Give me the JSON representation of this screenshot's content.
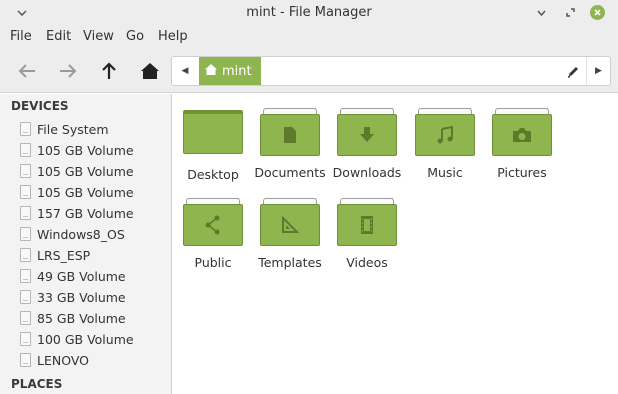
{
  "window": {
    "title": "mint - File Manager",
    "menu_icon": "chevron-down-icon",
    "minimize_icon": "minimize-icon",
    "maximize_icon": "maximize-icon",
    "close_icon": "close-icon",
    "accent": "#8fb54e"
  },
  "menubar": {
    "items": [
      "File",
      "Edit",
      "View",
      "Go",
      "Help"
    ]
  },
  "toolbar": {
    "back_icon": "arrow-left-icon",
    "forward_icon": "arrow-right-icon",
    "up_icon": "arrow-up-icon",
    "home_icon": "home-icon",
    "path": {
      "crumb_label": "mint",
      "crumb_icon": "home-icon",
      "edit_icon": "pencil-icon"
    }
  },
  "sidebar": {
    "devices_header": "DEVICES",
    "devices": [
      "File System",
      "105 GB Volume",
      "105 GB Volume",
      "105 GB Volume",
      "157 GB Volume",
      "Windows8_OS",
      "LRS_ESP",
      "49 GB Volume",
      "33 GB Volume",
      "85 GB Volume",
      "100 GB Volume",
      "LENOVO"
    ],
    "places_header": "PLACES"
  },
  "main": {
    "items": [
      {
        "label": "Desktop",
        "icon": "desktop-folder-icon"
      },
      {
        "label": "Documents",
        "icon": "documents-folder-icon"
      },
      {
        "label": "Downloads",
        "icon": "downloads-folder-icon"
      },
      {
        "label": "Music",
        "icon": "music-folder-icon"
      },
      {
        "label": "Pictures",
        "icon": "pictures-folder-icon"
      },
      {
        "label": "Public",
        "icon": "public-folder-icon"
      },
      {
        "label": "Templates",
        "icon": "templates-folder-icon"
      },
      {
        "label": "Videos",
        "icon": "videos-folder-icon"
      }
    ]
  }
}
